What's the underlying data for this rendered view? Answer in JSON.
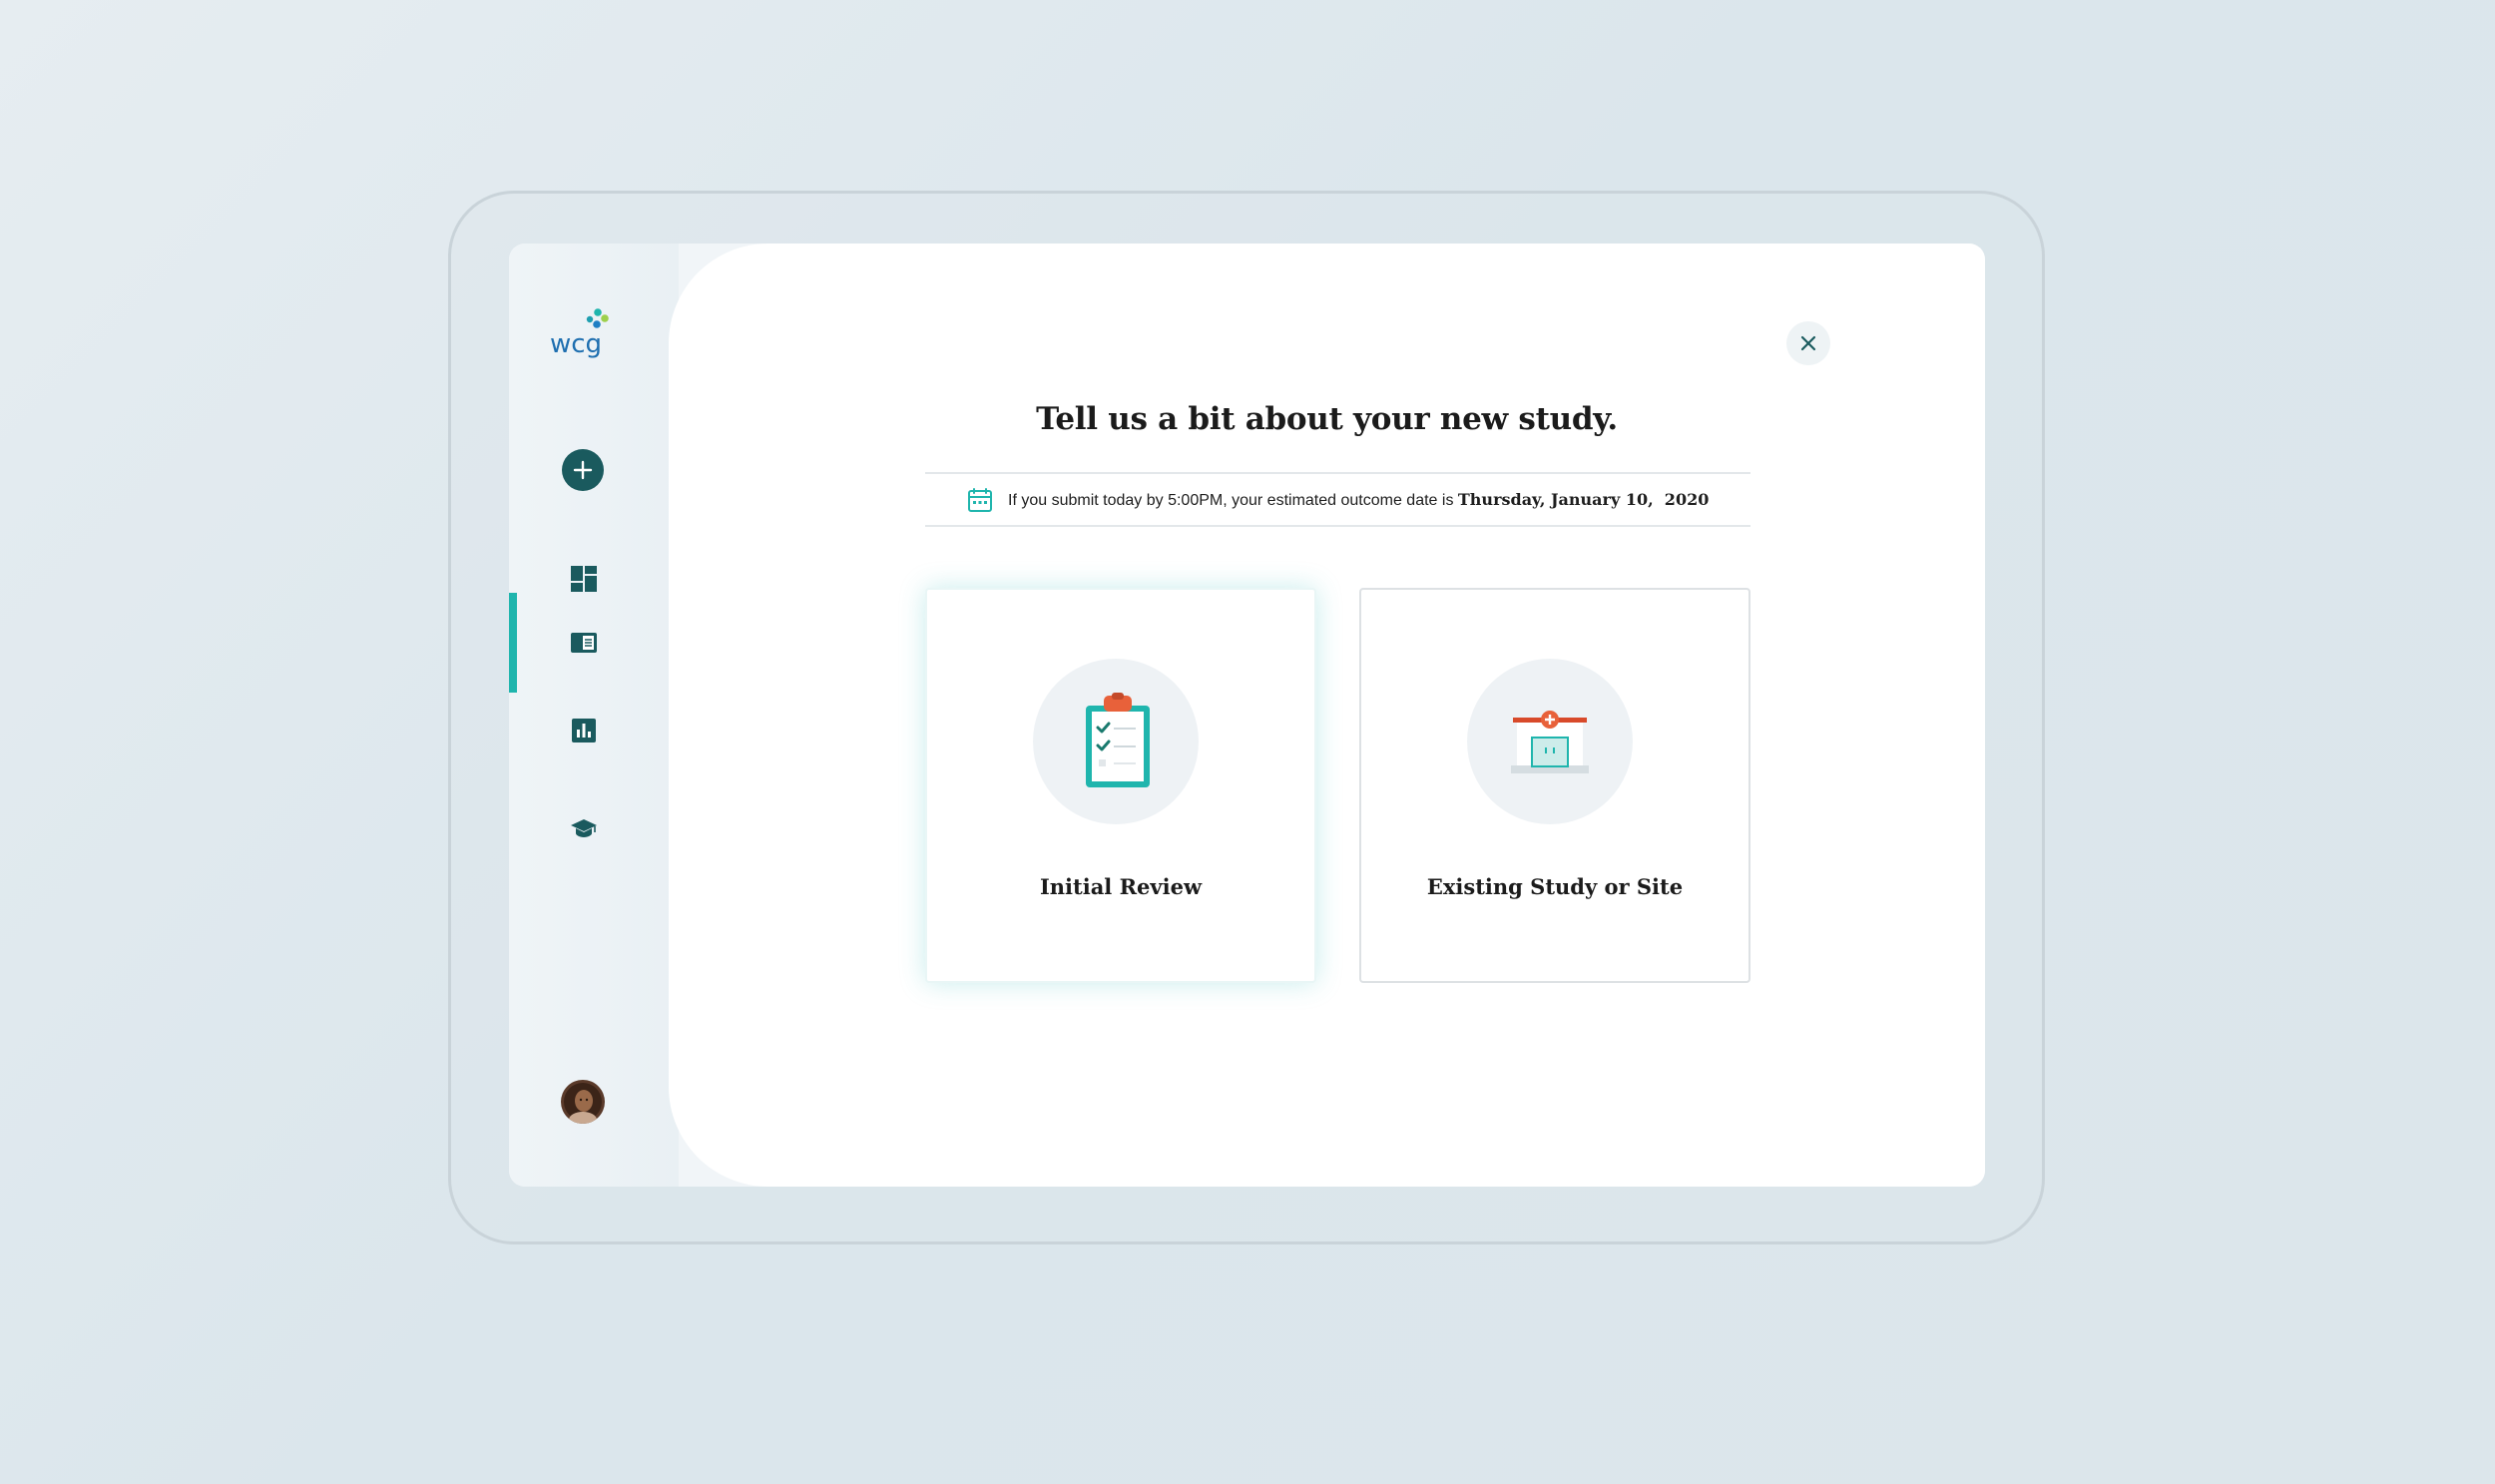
{
  "brand": {
    "logo_text": "wcg",
    "accent_color": "#1fb5ad",
    "primary_color": "#1a5a5e"
  },
  "sidebar": {
    "items": [
      {
        "name": "add-study",
        "icon": "plus-icon"
      },
      {
        "name": "dashboard",
        "icon": "dashboard-icon"
      },
      {
        "name": "studies",
        "icon": "studies-icon",
        "active": true
      },
      {
        "name": "reports",
        "icon": "bar-chart-icon"
      },
      {
        "name": "learning",
        "icon": "graduation-cap-icon"
      }
    ],
    "avatar": {
      "icon": "user-avatar"
    }
  },
  "modal": {
    "title": "Tell us a bit about your new study.",
    "info": {
      "icon": "calendar-icon",
      "prefix": "If you submit today by 5:00PM, your estimated outcome date is ",
      "date": "Thursday, January 10,  2020"
    },
    "options": [
      {
        "label": "Initial Review",
        "icon": "clipboard-checklist-icon",
        "selected": true
      },
      {
        "label": "Existing Study or Site",
        "icon": "hospital-building-icon",
        "selected": false
      }
    ],
    "close": {
      "icon": "close-icon"
    }
  }
}
